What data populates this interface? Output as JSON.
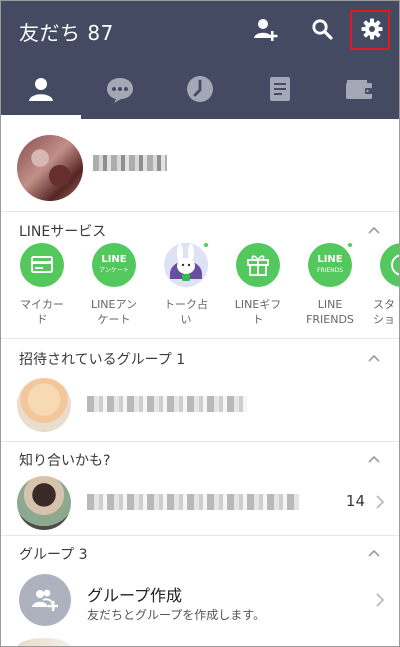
{
  "header": {
    "title": "友だち 87",
    "icons": [
      "add-friend-icon",
      "search-icon",
      "settings-icon"
    ],
    "highlight_color": "#e0191f",
    "bg_color": "#434a62"
  },
  "tabs": [
    {
      "id": "friends",
      "icon": "person-icon",
      "active": true
    },
    {
      "id": "chats",
      "icon": "chat-bubble-icon",
      "active": false
    },
    {
      "id": "timeline",
      "icon": "clock-icon",
      "active": false
    },
    {
      "id": "news",
      "icon": "news-icon",
      "active": false
    },
    {
      "id": "wallet",
      "icon": "wallet-icon",
      "active": false
    }
  ],
  "sections": {
    "line_services": "LINEサービス",
    "invited_groups": "招待されているグループ 1",
    "maybe_know": "知り合いかも?",
    "groups": "グループ 3"
  },
  "services": [
    {
      "label": "マイカー\nド",
      "icon": "card-icon",
      "badge": false,
      "ic_text": ""
    },
    {
      "label": "LINEアン\nケート",
      "icon": "line-survey-icon",
      "badge": false,
      "ic_text": "LINE"
    },
    {
      "label": "トーク占\nい",
      "icon": "fortune-character-icon",
      "badge": true,
      "ic_text": ""
    },
    {
      "label": "LINEギフ\nト",
      "icon": "gift-icon",
      "badge": false,
      "ic_text": ""
    },
    {
      "label": "LINE\nFRIENDS",
      "icon": "line-friends-icon",
      "badge": true,
      "ic_text": "LINE"
    },
    {
      "label": "スタ\nショ",
      "icon": "sticker-shop-icon",
      "badge": false,
      "ic_text": ""
    }
  ],
  "service_icon_texts": {
    "survey_sub": "アンケート",
    "friends_sub": "FRIENDS"
  },
  "suggested_count": "14",
  "group_create": {
    "title": "グループ作成",
    "subtitle": "友だちとグループを作成します。"
  }
}
